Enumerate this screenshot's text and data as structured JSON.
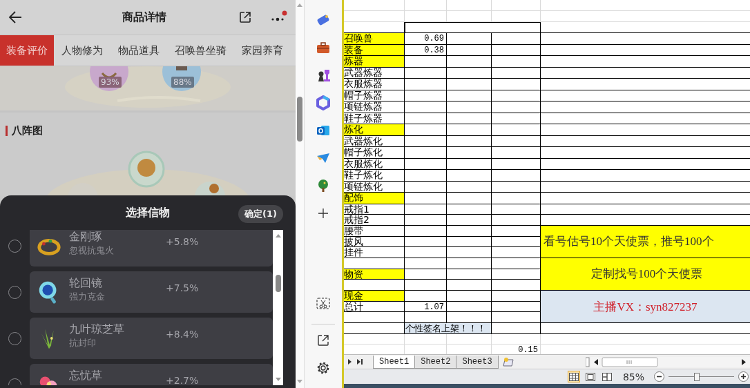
{
  "phone": {
    "title": "商品详情",
    "tabs": [
      {
        "label": "装备评价",
        "selected": true
      },
      {
        "label": "人物修为",
        "selected": false
      },
      {
        "label": "物品道具",
        "selected": false
      },
      {
        "label": "召唤兽坐骑",
        "selected": false
      },
      {
        "label": "家园养育",
        "selected": false
      }
    ],
    "badges": [
      "93%",
      "88%"
    ],
    "section_title": "八阵图",
    "dialog": {
      "title": "选择信物",
      "confirm": "确定(1)",
      "items": [
        {
          "kind": "ring",
          "name": "金刚琢",
          "desc": "忽视抗鬼火",
          "bonus": "+5.8%",
          "selected": false
        },
        {
          "kind": "mirror",
          "name": "轮回镜",
          "desc": "强力克金",
          "bonus": "+7.5%",
          "selected": false
        },
        {
          "kind": "herb",
          "name": "九叶琼芝草",
          "desc": "抗封印",
          "bonus": "+8.4%",
          "selected": false
        },
        {
          "kind": "flower",
          "name": "忘忧草",
          "bonus": "+2.7%",
          "selected": false
        }
      ]
    }
  },
  "spreadsheet": {
    "rows": [
      {
        "label": "召唤兽",
        "highlighted": true,
        "b": "0.69"
      },
      {
        "label": "装备",
        "highlighted": true,
        "b": "0.38"
      },
      {
        "label": "炼器",
        "highlighted": true
      },
      {
        "label": "武器炼器",
        "highlighted": false
      },
      {
        "label": "衣服炼器",
        "highlighted": false
      },
      {
        "label": "帽子炼器",
        "highlighted": false
      },
      {
        "label": "项链炼器",
        "highlighted": false
      },
      {
        "label": "鞋子炼器",
        "highlighted": false
      },
      {
        "label": "炼化",
        "highlighted": true
      },
      {
        "label": "武器炼化",
        "highlighted": false
      },
      {
        "label": "帽子炼化",
        "highlighted": false
      },
      {
        "label": "衣服炼化",
        "highlighted": false
      },
      {
        "label": "鞋子炼化",
        "highlighted": false
      },
      {
        "label": "项链炼化",
        "highlighted": false
      },
      {
        "label": "配饰",
        "highlighted": true
      },
      {
        "label": "戒指1",
        "highlighted": false
      },
      {
        "label": "戒指2",
        "highlighted": false
      },
      {
        "label": "腰带",
        "highlighted": false
      },
      {
        "label": "披风",
        "highlighted": false
      },
      {
        "label": "挂件",
        "highlighted": false
      },
      {
        "highlighted": false
      },
      {
        "label": "物资",
        "highlighted": true
      },
      {
        "highlighted": false
      },
      {
        "label": "现金",
        "highlighted": true
      },
      {
        "label": "总计",
        "highlighted": false,
        "b": "1.07"
      },
      {
        "highlighted": false
      },
      {
        "highlighted": false
      },
      {
        "highlighted": false
      },
      {
        "highlighted": false,
        "d": "0.15"
      }
    ],
    "notes": [
      {
        "kind": "yellow",
        "text": "看号估号10个天使票，推号100个"
      },
      {
        "kind": "yellow",
        "text": "定制找号100个天使票"
      },
      {
        "kind": "contact",
        "text": "主播VX：syn827237"
      }
    ],
    "signature": "个性签名上架！！！",
    "sheet_tabs": [
      {
        "label": "Sheet1",
        "selected": true
      },
      {
        "label": "Sheet2",
        "selected": false
      },
      {
        "label": "Sheet3",
        "selected": false
      }
    ],
    "views": [
      {
        "kind": "normal",
        "selected": true
      },
      {
        "kind": "layout",
        "selected": false
      },
      {
        "kind": "break",
        "selected": false
      }
    ],
    "zoom": {
      "reading": "85%",
      "level": 0.43
    }
  }
}
